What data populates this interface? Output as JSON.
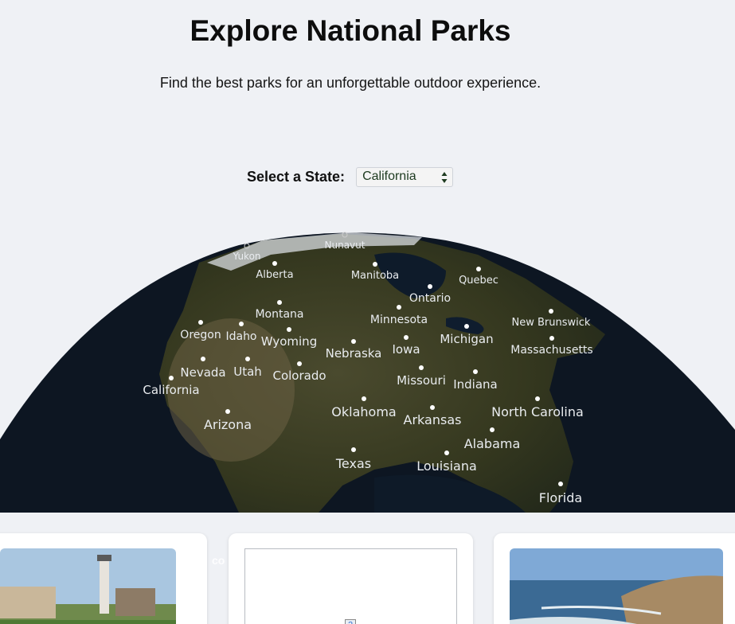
{
  "header": {
    "title": "Explore National Parks",
    "subtitle": "Find the best parks for an unforgettable outdoor experience."
  },
  "state_selector": {
    "label": "Select a State:",
    "selected": "California"
  },
  "map": {
    "region_labels": [
      "Yukon",
      "Nunavut",
      "Alberta",
      "Manitoba",
      "Quebec",
      "Ontario",
      "Montana",
      "Minnesota",
      "New Brunswick",
      "Oregon",
      "Idaho",
      "Wyoming",
      "Michigan",
      "Massachusetts",
      "Nebraska",
      "Iowa",
      "Nevada",
      "Utah",
      "Colorado",
      "Missouri",
      "Indiana",
      "California",
      "Oklahoma",
      "Arkansas",
      "North Carolina",
      "Arizona",
      "Alabama",
      "Texas",
      "Louisiana",
      "Florida"
    ]
  },
  "cards": {
    "partial_text": "co"
  },
  "colors": {
    "background": "#eff1f5",
    "space": "#141a24",
    "land": "#3b3e28",
    "water": "#0d1a2a",
    "marker": "#ffffff"
  }
}
